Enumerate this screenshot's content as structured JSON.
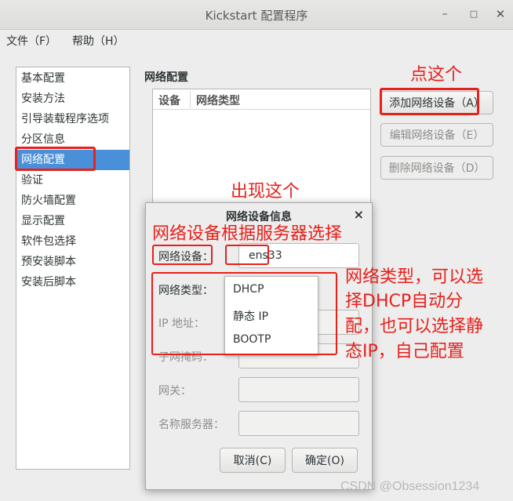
{
  "window": {
    "title": "Kickstart 配置程序",
    "min_icon": "minimize-icon",
    "max_icon": "maximize-icon",
    "close_icon": "close-icon"
  },
  "menubar": {
    "file": "文件（F）",
    "help": "帮助（H）"
  },
  "sidebar": {
    "items": [
      {
        "label": "基本配置"
      },
      {
        "label": "安装方法"
      },
      {
        "label": "引导装载程序选项"
      },
      {
        "label": "分区信息"
      },
      {
        "label": "网络配置",
        "selected": true
      },
      {
        "label": "验证"
      },
      {
        "label": "防火墙配置"
      },
      {
        "label": "显示配置"
      },
      {
        "label": "软件包选择"
      },
      {
        "label": "预安装脚本"
      },
      {
        "label": "安装后脚本"
      }
    ]
  },
  "main": {
    "section_title": "网络配置",
    "table_headers": [
      "设备",
      "网络类型"
    ],
    "buttons": {
      "add": "添加网络设备（A）",
      "edit": "编辑网络设备（E）",
      "delete": "删除网络设备（D）"
    }
  },
  "dialog": {
    "title": "网络设备信息",
    "close": "×",
    "device_label": "网络设备：",
    "device_value": "ens33",
    "type_label": "网络类型：",
    "ip_label": "IP 地址：",
    "netmask_label": "子网掩码：",
    "gateway_label": "网关：",
    "nameserver_label": "名称服务器：",
    "type_options": [
      "DHCP",
      "静态 IP",
      "BOOTP"
    ],
    "cancel": "取消(C)",
    "ok": "确定(O)"
  },
  "annotations": {
    "click_here": "点这个",
    "appears": "出现这个",
    "device_note": "网络设备根据服务器选择",
    "type_note_lines": [
      "网络类型，可以选",
      "择DHCP自动分",
      "配，也可以选择静",
      "态IP，自己配置"
    ]
  },
  "watermark": "CSDN @Obsession1234",
  "colors": {
    "selection": "#4a90d9",
    "annotation_red": "#e8201b"
  }
}
